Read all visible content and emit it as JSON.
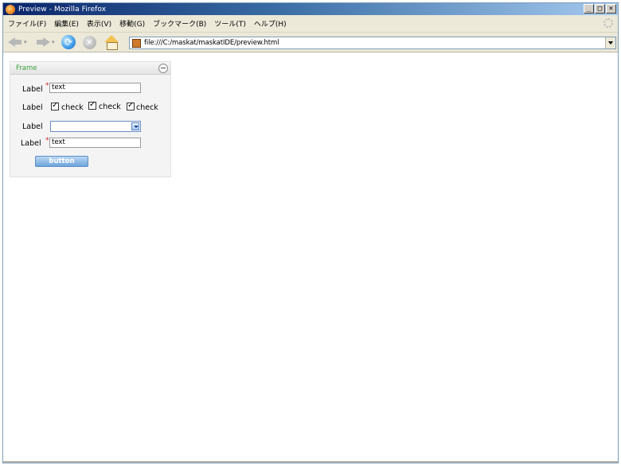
{
  "window": {
    "title": "Preview - Mozilla Firefox",
    "controls": {
      "minimize": "_",
      "maximize": "□",
      "close": "×"
    }
  },
  "menubar": {
    "items": [
      "ファイル(F)",
      "編集(E)",
      "表示(V)",
      "移動(G)",
      "ブックマーク(B)",
      "ツール(T)",
      "ヘルプ(H)"
    ]
  },
  "navbar": {
    "url": "file:///C:/maskat/maskatIDE/preview.html",
    "icons": [
      "back-icon",
      "forward-icon",
      "reload-icon",
      "stop-icon",
      "home-icon"
    ]
  },
  "frame": {
    "title": "Frame",
    "rows": [
      {
        "label": "Label",
        "type": "text",
        "required": true,
        "value": "text"
      },
      {
        "label": "Label",
        "type": "checkboxes",
        "checkboxes": [
          "check",
          "check",
          "check"
        ]
      },
      {
        "label": "Label",
        "type": "select",
        "value": ""
      },
      {
        "label": "Label",
        "type": "text",
        "required": true,
        "value": "text"
      }
    ],
    "required_mark": "*",
    "button_label": "button"
  },
  "colors": {
    "title_bar": "#0a246a",
    "frame_title": "#3aa23a",
    "required": "#d02020",
    "button": "#6ea4da"
  }
}
